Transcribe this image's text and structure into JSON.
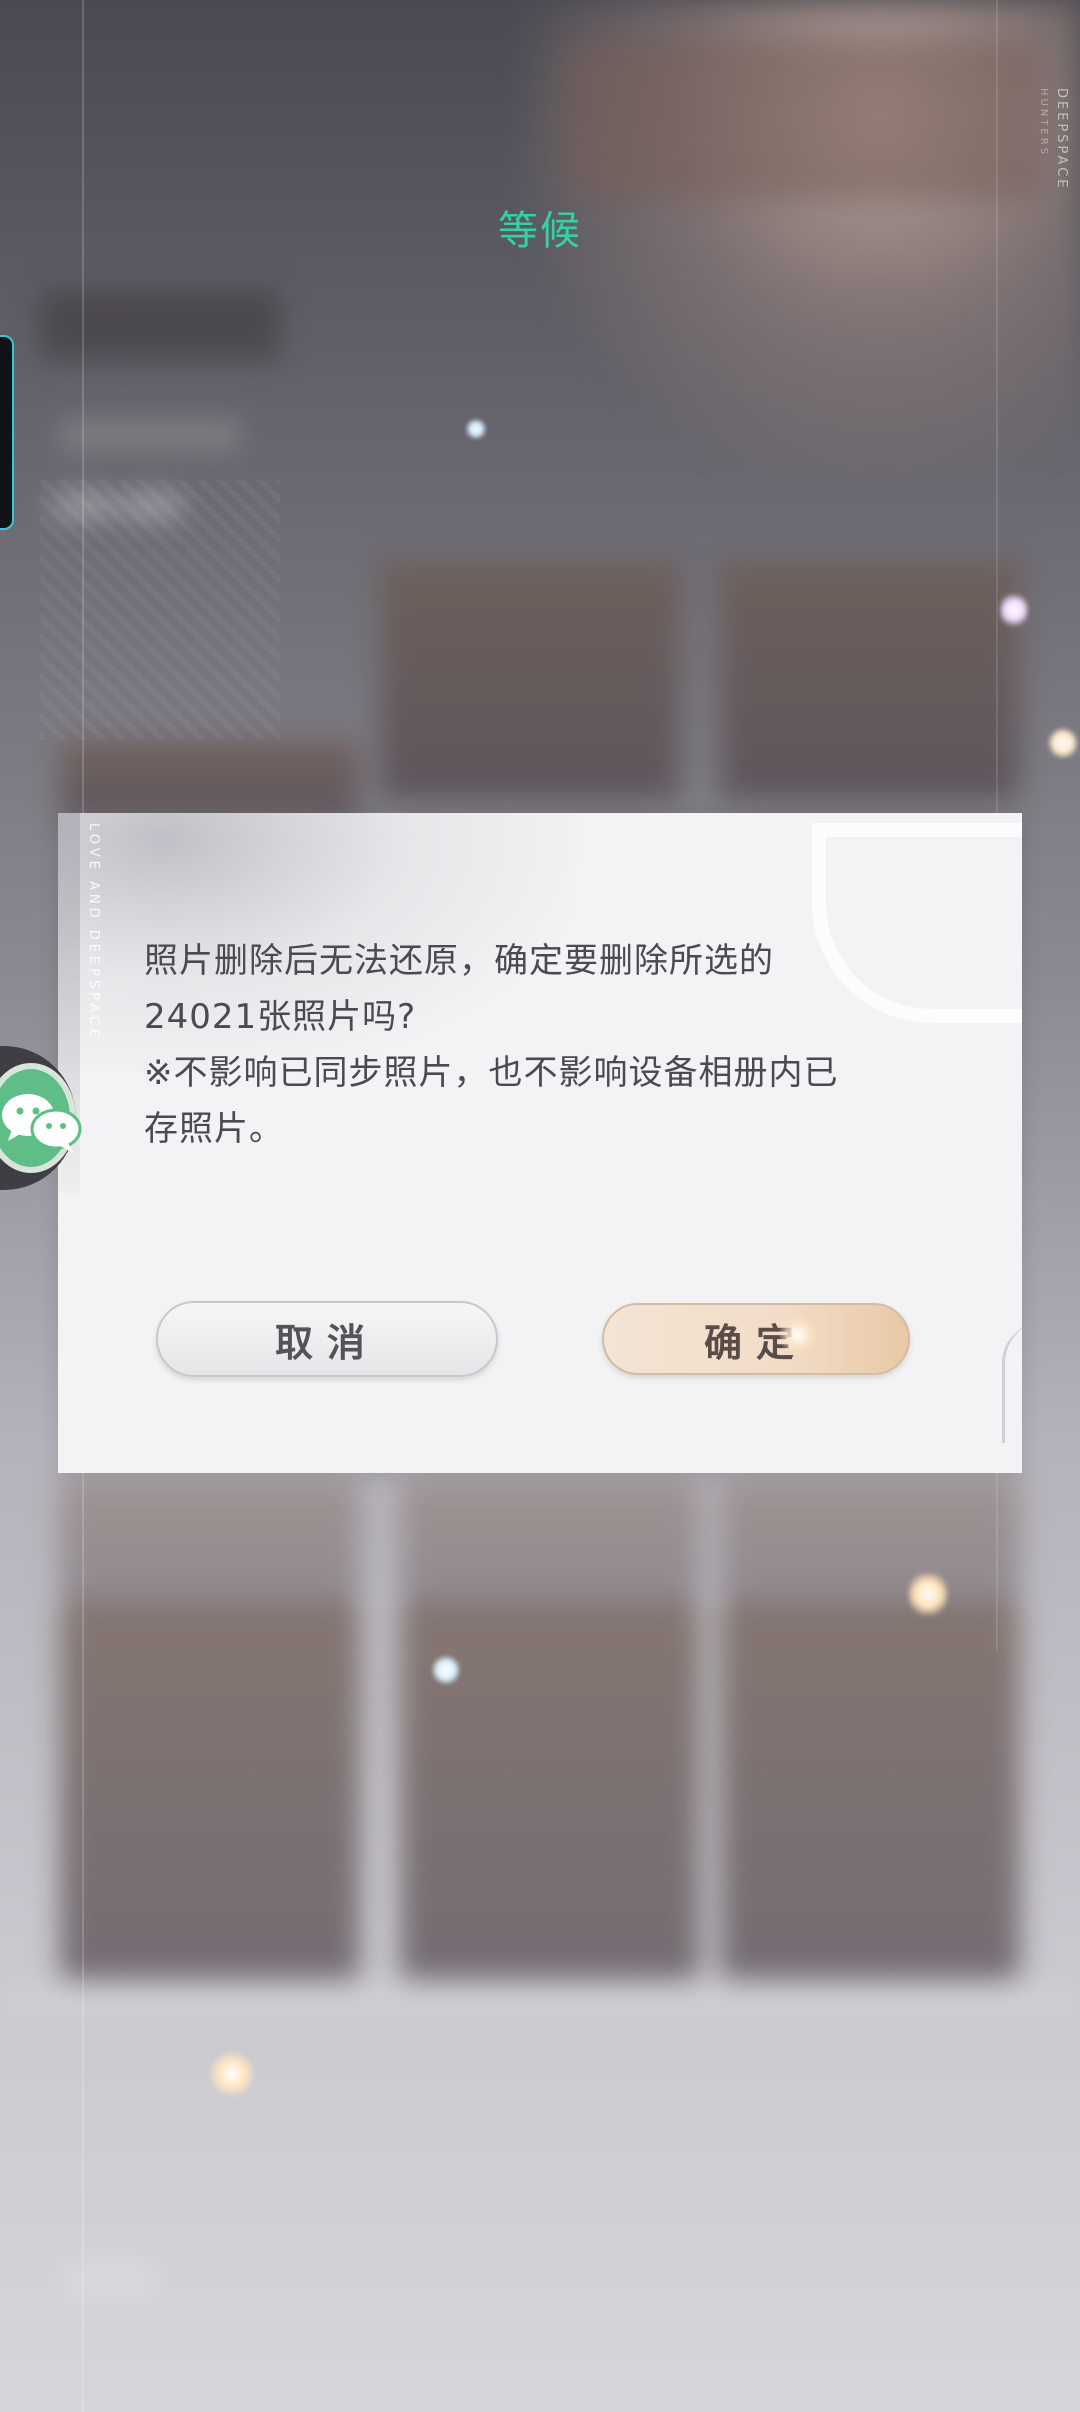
{
  "header": {
    "title": "等候"
  },
  "brand": {
    "vertical_text": "DEEPSPACE",
    "vertical_subtext": "HUNTERS"
  },
  "dialog": {
    "vertical_text": "LOVE AND DEEPSPACE",
    "message_line1": "照片删除后无法还原，确定要删除所选的\n24021张照片吗?",
    "message_line2": "※不影响已同步照片，也不影响设备相册内已\n存照片。",
    "cancel_label": "取消",
    "confirm_label": "确定"
  },
  "floating": {
    "icon": "wechat-icon"
  },
  "colors": {
    "title_accent": "#34d0a8",
    "edge_tab_border": "#33c9d6",
    "wechat_green": "#5fbd88"
  }
}
